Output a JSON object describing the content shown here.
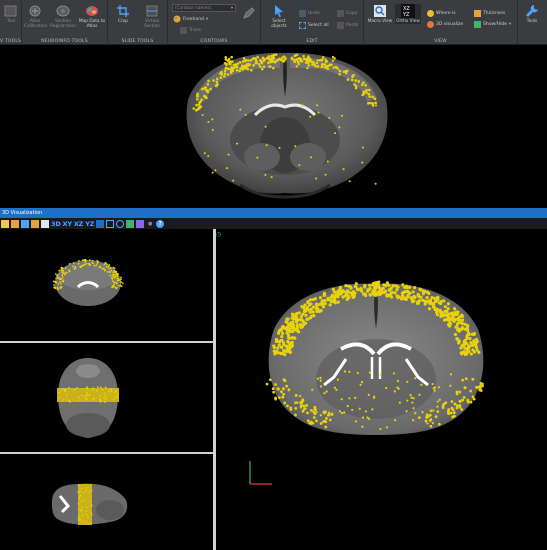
{
  "ribbon": {
    "groups": {
      "tools": "V TOOLS",
      "neuroinfo": "NEUROINFO TOOLS",
      "slide": "SLIDE TOOLS",
      "contours": "CONTOURS",
      "edit": "EDIT",
      "view": "VIEW"
    },
    "buttons": {
      "tool_a": "Tool",
      "atlas_calibration": "Atlas Calibration",
      "section_registration": "Section Registration",
      "map_data_to_atlas": "Map Data to Atlas",
      "crop": "Crop",
      "virtual_section": "Virtual Section",
      "contour_dropdown": "(Contour names)",
      "freehand": "Freehand",
      "trace": "Trace",
      "select_objects": "Select objects",
      "undo": "Undo",
      "select_all": "Select all",
      "copy": "Copy",
      "paste": "Paste",
      "macro_view": "Macro View",
      "ortho_view": "Ortho View",
      "where_is": "Where is",
      "visualize_3d": "3D visualize",
      "thickness": "Thickness",
      "show_hide": "Show/Hide",
      "tools": "Tools"
    },
    "colors": {
      "background": "#3a3c3f",
      "accent": "#1e6fc8",
      "marker": "#e8d20a"
    }
  },
  "window": {
    "title": "3D Visualization",
    "toolbar": {
      "mode_3d": "3D",
      "mode_xy": "XY",
      "mode_xz": "XZ",
      "mode_yz": "YZ"
    }
  },
  "views": {
    "top": {
      "label": "coronal section with markers",
      "icon": "brain-coronal"
    },
    "panes": [
      "coronal",
      "horizontal",
      "sagittal",
      "coronal-large"
    ]
  }
}
